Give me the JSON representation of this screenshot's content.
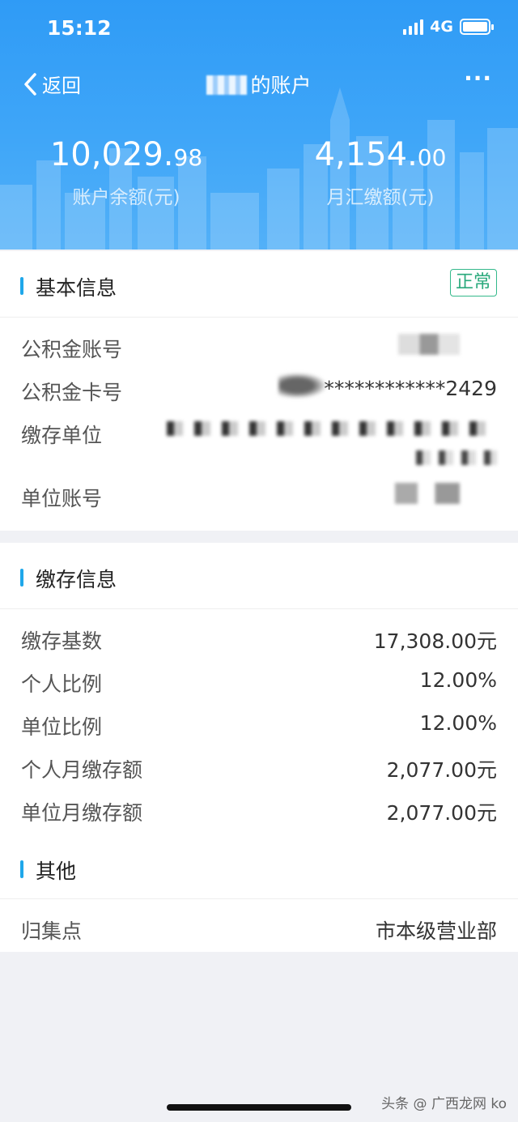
{
  "status": {
    "time": "15:12",
    "network": "4G"
  },
  "nav": {
    "back_label": "返回",
    "title": "的账户"
  },
  "summary": {
    "balance_int": "10,029.",
    "balance_dec": "98",
    "balance_caption": "账户余额(元)",
    "monthly_int": "4,154.",
    "monthly_dec": "00",
    "monthly_caption": "月汇缴额(元)"
  },
  "basic": {
    "title": "基本信息",
    "status_badge": "正常",
    "rows": [
      {
        "label": "公积金账号",
        "value": ""
      },
      {
        "label": "公积金卡号",
        "value": "************2429"
      },
      {
        "label": "缴存单位",
        "value": ""
      },
      {
        "label": "单位账号",
        "value": ""
      }
    ]
  },
  "deposit": {
    "title": "缴存信息",
    "rows": [
      {
        "label": "缴存基数",
        "value": "17,308.00元"
      },
      {
        "label": "个人比例",
        "value": "12.00%"
      },
      {
        "label": "单位比例",
        "value": "12.00%"
      },
      {
        "label": "个人月缴存额",
        "value": "2,077.00元"
      },
      {
        "label": "单位月缴存额",
        "value": "2,077.00元"
      }
    ]
  },
  "other": {
    "title": "其他",
    "rows": [
      {
        "label": "归集点",
        "value": "市本级营业部"
      }
    ]
  },
  "watermark": "头条 @ 广西龙网 ko"
}
